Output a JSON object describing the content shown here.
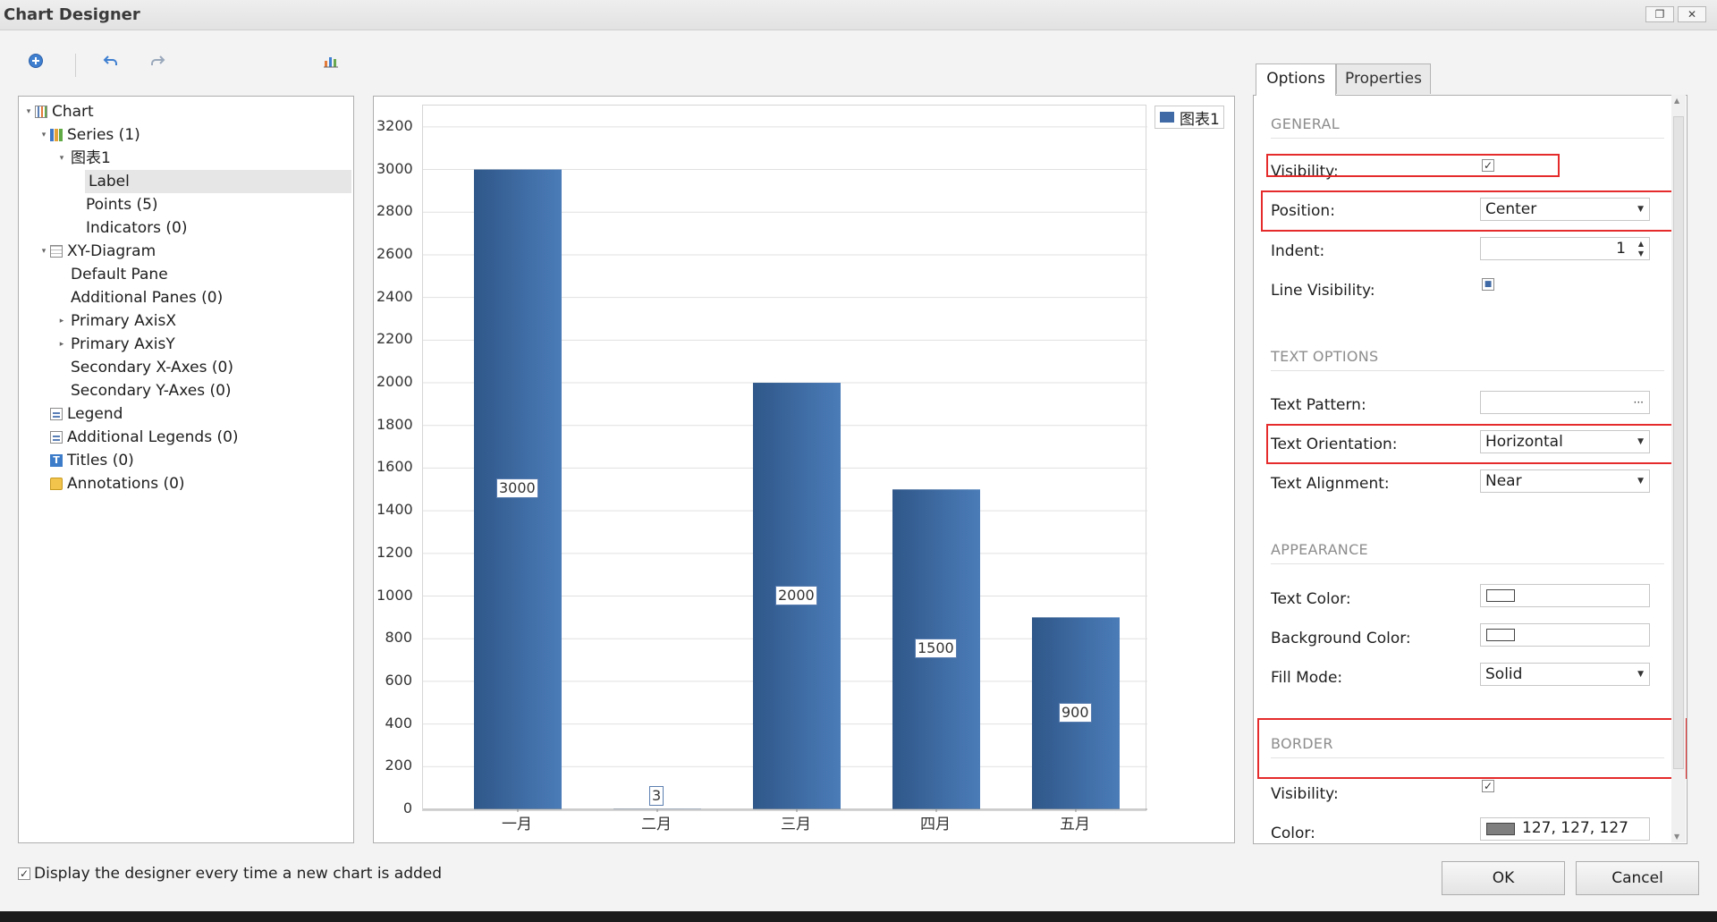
{
  "window": {
    "title": "Chart Designer"
  },
  "tree": [
    {
      "label": "Chart",
      "level": 0,
      "expander": "collapse",
      "icon": "chart-icon"
    },
    {
      "label": "Series (1)",
      "level": 1,
      "expander": "collapse",
      "icon": "series-icon"
    },
    {
      "label": "图表1",
      "level": 2,
      "expander": "collapse",
      "icon": ""
    },
    {
      "label": "Label",
      "level": 3,
      "expander": "",
      "icon": "",
      "selected": true
    },
    {
      "label": "Points (5)",
      "level": 3,
      "expander": "",
      "icon": ""
    },
    {
      "label": "Indicators (0)",
      "level": 3,
      "expander": "",
      "icon": ""
    },
    {
      "label": "XY-Diagram",
      "level": 1,
      "expander": "collapse",
      "icon": "diagram-icon"
    },
    {
      "label": "Default Pane",
      "level": 2,
      "expander": "",
      "icon": ""
    },
    {
      "label": "Additional Panes (0)",
      "level": 2,
      "expander": "",
      "icon": ""
    },
    {
      "label": "Primary AxisX",
      "level": 2,
      "expander": "expand",
      "icon": ""
    },
    {
      "label": "Primary AxisY",
      "level": 2,
      "expander": "expand",
      "icon": ""
    },
    {
      "label": "Secondary X-Axes (0)",
      "level": 2,
      "expander": "",
      "icon": ""
    },
    {
      "label": "Secondary Y-Axes (0)",
      "level": 2,
      "expander": "",
      "icon": ""
    },
    {
      "label": "Legend",
      "level": 1,
      "expander": "",
      "icon": "legend-icon"
    },
    {
      "label": "Additional Legends (0)",
      "level": 1,
      "expander": "",
      "icon": "legend-icon"
    },
    {
      "label": "Titles (0)",
      "level": 1,
      "expander": "",
      "icon": "title-icon"
    },
    {
      "label": "Annotations (0)",
      "level": 1,
      "expander": "",
      "icon": "annotation-icon"
    }
  ],
  "chart_data": {
    "type": "bar",
    "categories": [
      "一月",
      "二月",
      "三月",
      "四月",
      "五月"
    ],
    "series": [
      {
        "name": "图表1",
        "values": [
          3000,
          3,
          2000,
          1500,
          900
        ],
        "color": "#3f6aa5"
      }
    ],
    "yticks": [
      0,
      200,
      400,
      600,
      800,
      1000,
      1200,
      1400,
      1600,
      1800,
      2000,
      2200,
      2400,
      2600,
      2800,
      3000,
      3200
    ],
    "ylim": [
      0,
      3300
    ],
    "title": "",
    "xlabel": "",
    "ylabel": "",
    "legend": "top-right",
    "grid": true
  },
  "tabs": {
    "options": "Options",
    "properties": "Properties"
  },
  "options": {
    "general": "GENERAL",
    "visibility_label": "Visibility:",
    "visibility_checked": true,
    "position_label": "Position:",
    "position_value": "Center",
    "indent_label": "Indent:",
    "indent_value": "1",
    "line_visibility_label": "Line Visibility:",
    "text_options": "TEXT OPTIONS",
    "text_pattern_label": "Text Pattern:",
    "text_pattern_button": "···",
    "text_orientation_label": "Text Orientation:",
    "text_orientation_value": "Horizontal",
    "text_alignment_label": "Text Alignment:",
    "text_alignment_value": "Near",
    "appearance": "APPEARANCE",
    "text_color_label": "Text Color:",
    "background_color_label": "Background Color:",
    "fill_mode_label": "Fill Mode:",
    "fill_mode_value": "Solid",
    "border": "BORDER",
    "border_visibility_label": "Visibility:",
    "border_color_label": "Color:",
    "border_color_value": "127, 127, 127",
    "border_color_hex": "#7f7f7f"
  },
  "footer": {
    "show_designer_label": "Display the designer every time a new chart is added",
    "ok": "OK",
    "cancel": "Cancel"
  }
}
